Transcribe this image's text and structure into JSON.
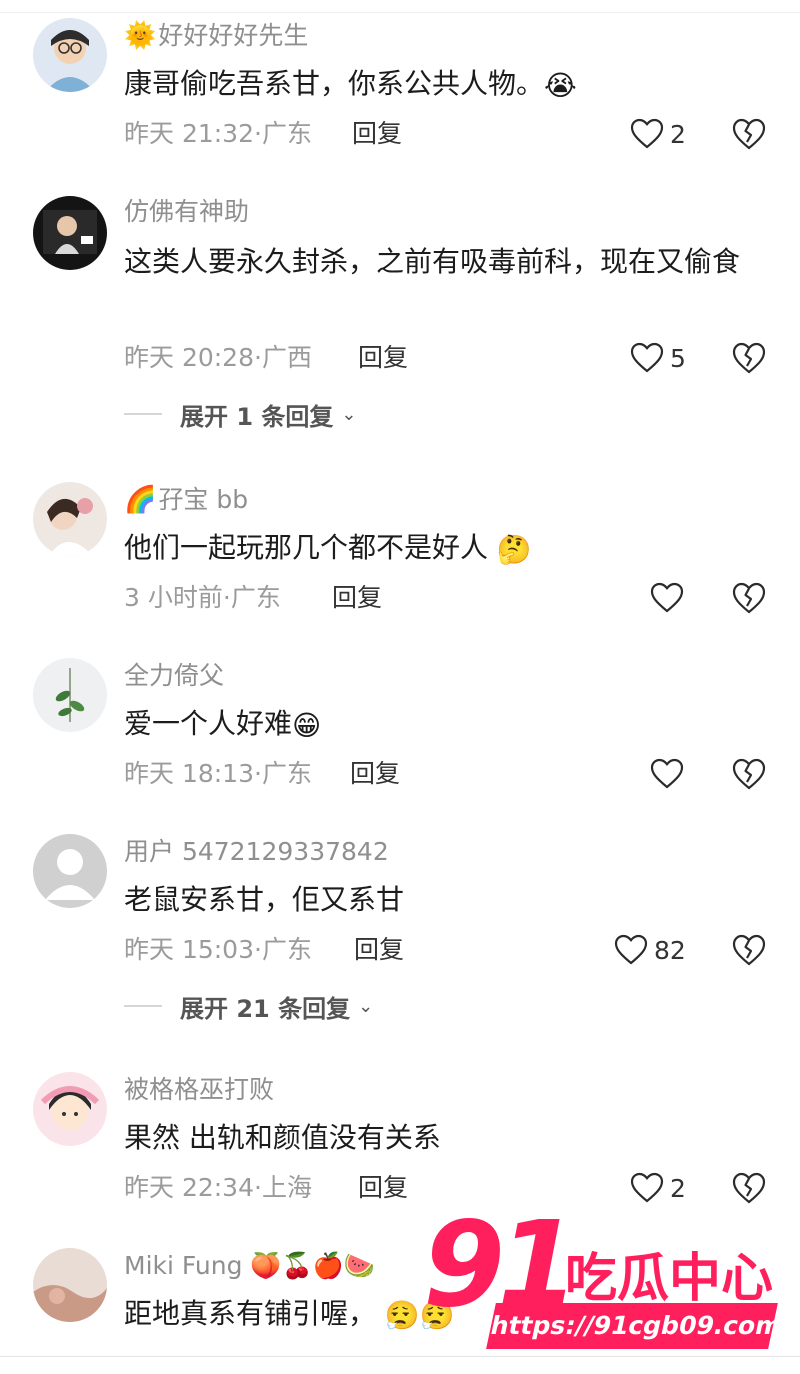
{
  "comments": [
    {
      "username": "好好好好先生",
      "username_prefix": "🌞",
      "text": "康哥偷吃吾系甘，你系公共人物。",
      "text_emoji": "😭",
      "time": "昨天 21:32",
      "location": "广东",
      "reply": "回复",
      "likes": "2"
    },
    {
      "username": "仿佛有神助",
      "username_prefix": "",
      "text": "这类人要永久封杀，之前有吸毒前科，现在又偷食",
      "text_emoji": "",
      "time": "昨天 20:28",
      "location": "广西",
      "reply": "回复",
      "likes": "5",
      "expand": "展开 1 条回复"
    },
    {
      "username": "孖宝 bb",
      "username_prefix": "🌈",
      "text": "他们一起玩那几个都不是好人",
      "text_emoji": "🤔",
      "time": "3 小时前",
      "location": "广东",
      "reply": "回复",
      "likes": ""
    },
    {
      "username": "全力倚父",
      "username_prefix": "",
      "text": "爱一个人好难",
      "text_emoji": "😁",
      "time": "昨天 18:13",
      "location": "广东",
      "reply": "回复",
      "likes": ""
    },
    {
      "username": "用户 5472129337842",
      "username_prefix": "",
      "text": "老鼠安系甘，佢又系甘",
      "text_emoji": "",
      "time": "昨天 15:03",
      "location": "广东",
      "reply": "回复",
      "likes": "82",
      "expand": "展开 21 条回复"
    },
    {
      "username": "被格格巫打败",
      "username_prefix": "",
      "text": "果然 出轨和颜值没有关系",
      "text_emoji": "",
      "time": "昨天 22:34",
      "location": "上海",
      "reply": "回复",
      "likes": "2"
    },
    {
      "username": "Miki Fung",
      "username_suffix": "🍑🍒🍎🍉",
      "text": "距地真系有铺引喔，",
      "text_emoji": "😮‍💨😮‍💨"
    }
  ],
  "separator": "·",
  "watermark": {
    "number": "91",
    "name": "吃瓜中心",
    "url": "https://91cgb09.com"
  },
  "colors": {
    "username": "#8f8f8f",
    "meta": "#9b9b9b",
    "watermark": "#ff1f5c"
  }
}
